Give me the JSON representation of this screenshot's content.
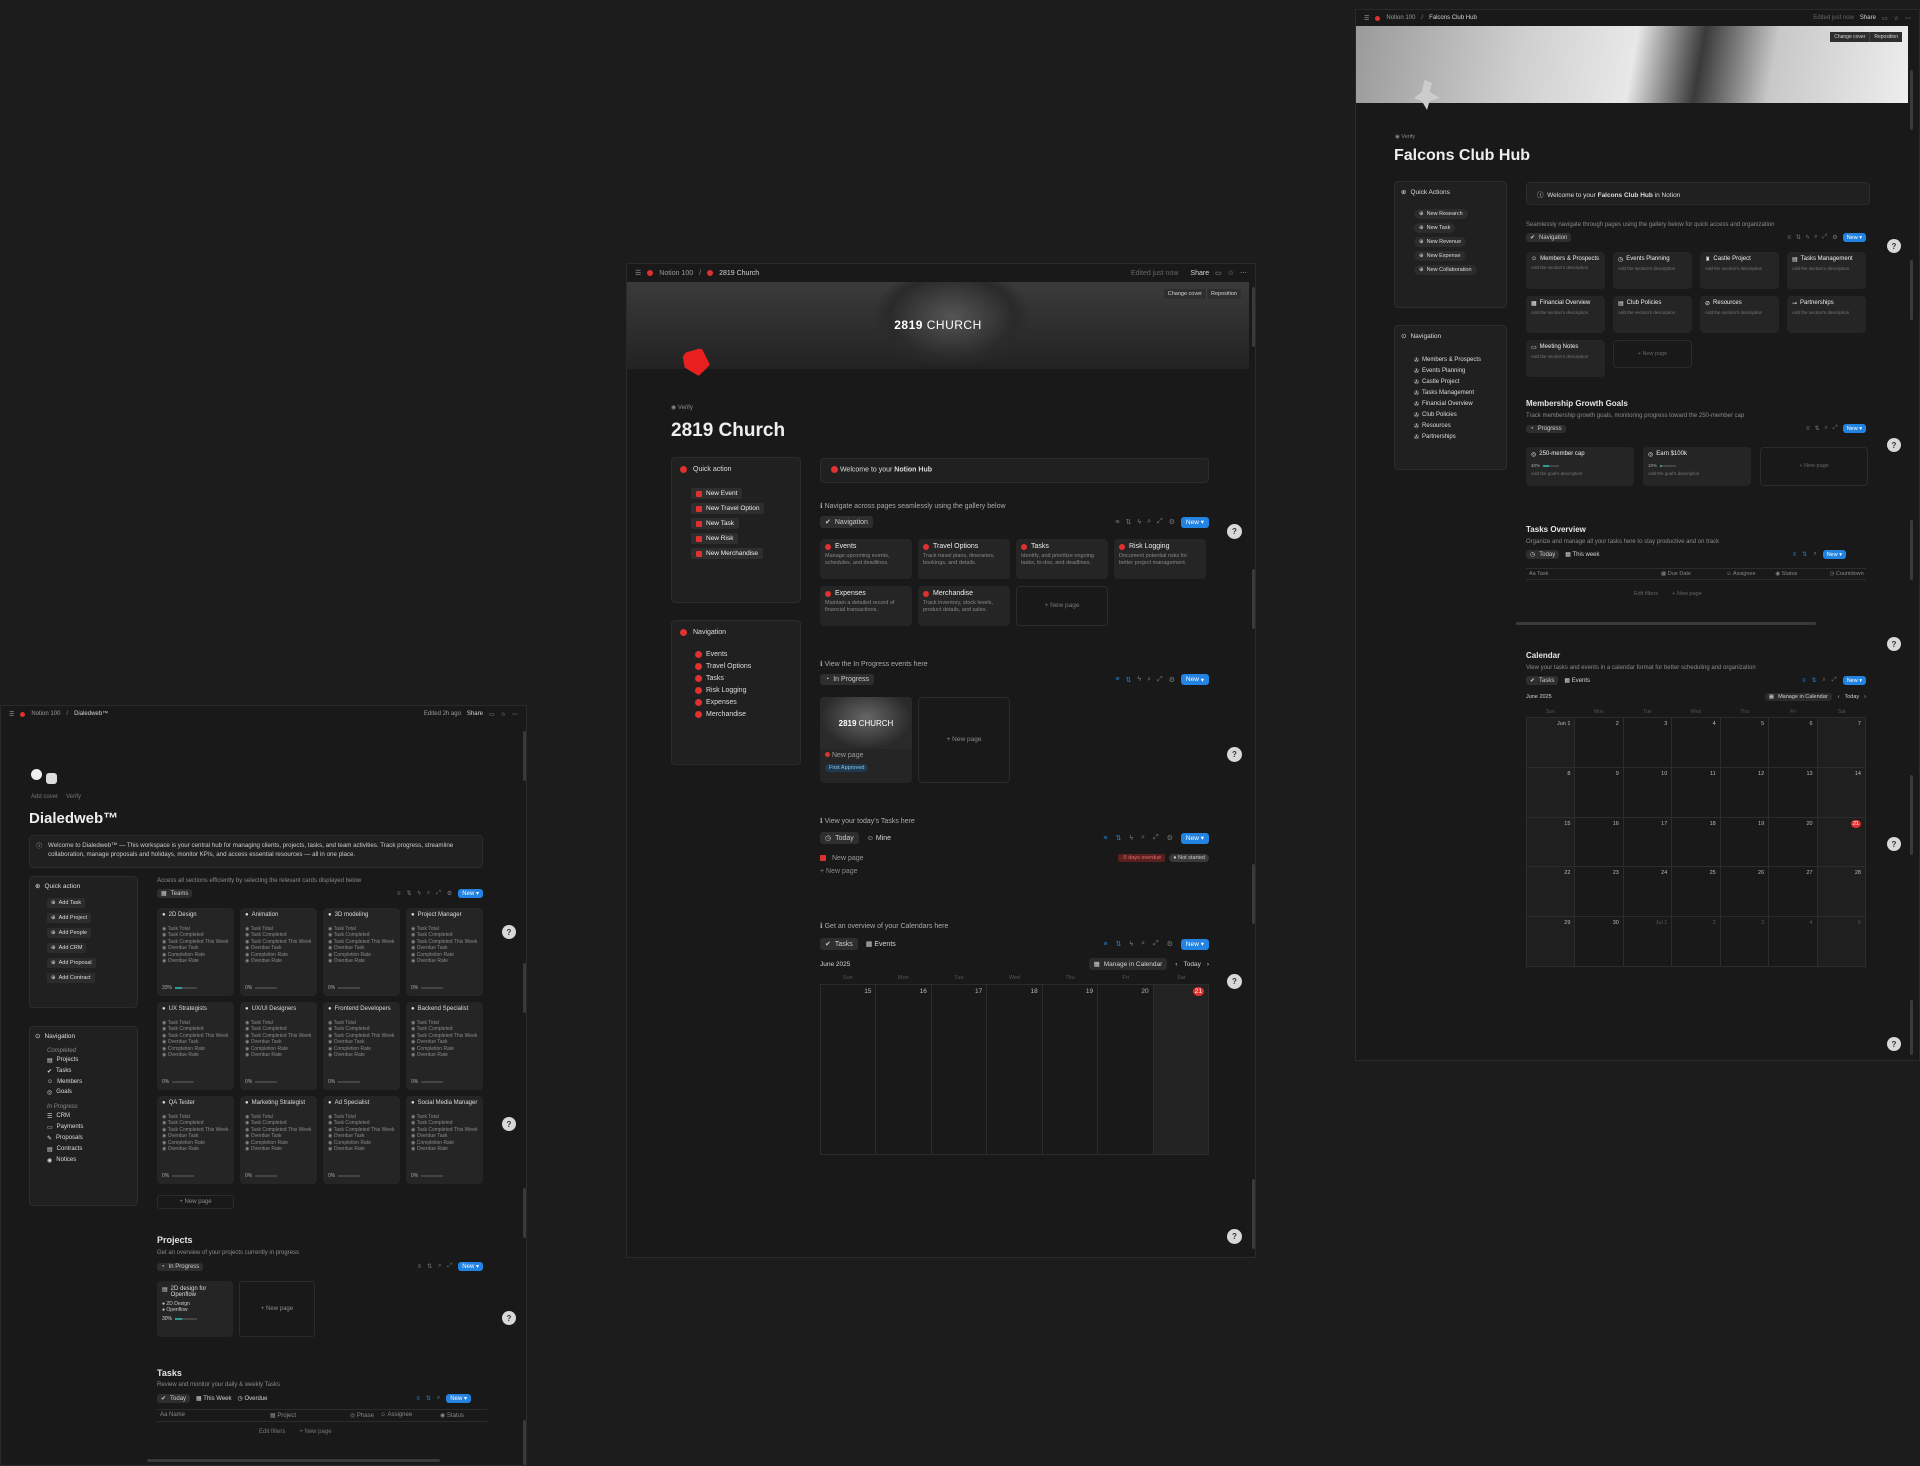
{
  "center": {
    "titlebar": {
      "workspace": "Notion 100",
      "page": "2819 Church",
      "edited": "Edited just now",
      "share": "Share"
    },
    "cover": {
      "brand_bold": "2819",
      "brand_light": "CHURCH",
      "change_cover": "Change cover",
      "reposition": "Reposition"
    },
    "verify": "Verify",
    "title": "2819 Church",
    "quick": {
      "title": "Quick action",
      "items": [
        "New Event",
        "New Travel Option",
        "New Task",
        "New Risk",
        "New Merchandise"
      ]
    },
    "nav": {
      "title": "Navigation",
      "items": [
        "Events",
        "Travel Options",
        "Tasks",
        "Risk Logging",
        "Expenses",
        "Merchandise"
      ]
    },
    "welcome": {
      "pre": "Welcome to your ",
      "bold": "Notion Hub"
    },
    "gallery": {
      "hint": "ℹ Navigate across pages seamlessly using the gallery below",
      "view": "Navigation",
      "new": "New",
      "cards": [
        {
          "title": "Events",
          "desc": "Manage upcoming events, schedules, and deadlines."
        },
        {
          "title": "Travel Options",
          "desc": "Track travel plans, itineraries, bookings, and details."
        },
        {
          "title": "Tasks",
          "desc": "Identify, and prioritize ongoing tasks, to-dos, and deadlines."
        },
        {
          "title": "Risk Logging",
          "desc": "Document potential risks for better project management."
        },
        {
          "title": "Expenses",
          "desc": "Maintain a detailed record of financial transactions."
        },
        {
          "title": "Merchandise",
          "desc": "Track inventory, stock levels, product details, and sales."
        }
      ],
      "new_page": "+ New page"
    },
    "inprog": {
      "hint": "ℹ View the In Progress events here",
      "view": "In Progress",
      "new": "New",
      "card_title": "New page",
      "badge": "First Approved",
      "new_page": "+ New page"
    },
    "tasks": {
      "hint": "ℹ View your today's Tasks here",
      "view1": "Today",
      "view2": "Mine",
      "new": "New",
      "row": "New page",
      "overdue": "-5 days overdue",
      "status": "Not started",
      "new_page": "+ New page"
    },
    "cal": {
      "hint": "ℹ Get an overview of your Calendars here",
      "view1": "Tasks",
      "view2": "Events",
      "new": "New",
      "month": "June 2025",
      "manage": "Manage in Calendar",
      "today": "Today",
      "days": [
        "Sun",
        "Mon",
        "Tue",
        "Wed",
        "Thu",
        "Fri",
        "Sat"
      ],
      "dates": [
        "15",
        "16",
        "17",
        "18",
        "19",
        "20",
        "21"
      ]
    }
  },
  "right": {
    "titlebar": {
      "workspace": "Notion 100",
      "page": "Falcons Club Hub",
      "edited": "Edited just now",
      "share": "Share"
    },
    "cover": {
      "change_cover": "Change cover",
      "reposition": "Reposition"
    },
    "verify": "Verify",
    "title": "Falcons Club Hub",
    "quick": {
      "title": "Quick Actions",
      "items": [
        "New Research",
        "New Task",
        "New Revenue",
        "New Expense",
        "New Collaboration"
      ]
    },
    "nav": {
      "title": "Navigation",
      "items": [
        "Members & Prospects",
        "Events Planning",
        "Castle Project",
        "Tasks Management",
        "Financial Overview",
        "Club Policies",
        "Resources",
        "Partnerships"
      ]
    },
    "welcome": {
      "pre": "Welcome to your ",
      "bold": "Falcons Club Hub",
      "post": " in Notion"
    },
    "gallery": {
      "hint": "Seamlessly navigate through pages using the gallery below for quick access and organization",
      "view": "Navigation",
      "new": "New",
      "cards": [
        "Members & Prospects",
        "Events Planning",
        "Castle Project",
        "Tasks Management",
        "Financial Overview",
        "Club Policies",
        "Resources",
        "Partnerships",
        "Meeting Notes"
      ],
      "desc": "Add the section's description",
      "new_page": "+ New page"
    },
    "growth": {
      "title": "Membership Growth Goals",
      "sub": "Track membership growth goals, monitoring progress toward the 250-member cap",
      "view": "Progress",
      "new": "New",
      "cards": [
        {
          "title": "250-member cap",
          "pct": "40%",
          "progress": 0.4
        },
        {
          "title": "Earn $100k",
          "pct": "10%",
          "progress": 0.1
        }
      ],
      "desc": "Add the goal's description",
      "new_page": "+ New page"
    },
    "tasks": {
      "title": "Tasks Overview",
      "sub": "Organize and manage all your tasks here to stay productive and on track",
      "view1": "Today",
      "view2": "This week",
      "new": "New",
      "cols": [
        "Task",
        "Due Date",
        "Assignee",
        "Status",
        "Countdown"
      ],
      "edit_filters": "Edit filters",
      "new_page": "+ New page"
    },
    "cal": {
      "title": "Calendar",
      "sub": "View your tasks and events in a calendar format for better scheduling and organization",
      "view1": "Tasks",
      "view2": "Events",
      "new": "New",
      "month": "June 2025",
      "manage": "Manage in Calendar",
      "today": "Today",
      "days": [
        "Sun",
        "Mon",
        "Tue",
        "Wed",
        "Thu",
        "Fri",
        "Sat"
      ],
      "dates": [
        "Jun 1",
        "2",
        "3",
        "4",
        "5",
        "6",
        "7",
        "8",
        "9",
        "10",
        "11",
        "12",
        "13",
        "14",
        "15",
        "16",
        "17",
        "18",
        "19",
        "20",
        "21",
        "22",
        "23",
        "24",
        "25",
        "26",
        "27",
        "28",
        "29",
        "30",
        "Jul 1",
        "2",
        "3",
        "4",
        "5"
      ]
    }
  },
  "left": {
    "titlebar": {
      "workspace": "Notion 100",
      "page": "Dialedweb™",
      "edited": "Edited 2h ago",
      "share": "Share"
    },
    "add_cover": "Add cover",
    "verify": "Verify",
    "title": "Dialedweb™",
    "welcome": "Welcome to Dialedweb™ — This workspace is your central hub for managing clients, projects, tasks, and team activities. Track progress, streamline collaboration, manage proposals and holidays, monitor KPIs, and access essential resources — all in one place.",
    "quick": {
      "title": "Quick action",
      "items": [
        "Add Task",
        "Add Project",
        "Add People",
        "Add CRM",
        "Add Proposal",
        "Add Contract"
      ]
    },
    "nav": {
      "title": "Navigation",
      "completed": "Completed",
      "completed_items": [
        "Projects",
        "Tasks",
        "Members",
        "Goals"
      ],
      "inprogress": "In Progress",
      "inprogress_items": [
        "CRM",
        "Payments",
        "Proposals",
        "Contracts",
        "Notices"
      ]
    },
    "teams": {
      "hint": "Access all sections efficiently by selecting the relevant cards displayed below",
      "view": "Teams",
      "new": "New",
      "cards": [
        {
          "title": "2D Design",
          "pct": "33%"
        },
        {
          "title": "Animation",
          "pct": "0%"
        },
        {
          "title": "3D modeling",
          "pct": "0%"
        },
        {
          "title": "Project Manager",
          "pct": "0%"
        },
        {
          "title": "UX Strategists",
          "pct": "0%"
        },
        {
          "title": "UX/UI Designers",
          "pct": "0%"
        },
        {
          "title": "Frontend Developers",
          "pct": "0%"
        },
        {
          "title": "Backend Specialist",
          "pct": "0%"
        },
        {
          "title": "QA Tester",
          "pct": "0%"
        },
        {
          "title": "Marketing Strategist",
          "pct": "0%"
        },
        {
          "title": "Ad Specialist",
          "pct": "0%"
        },
        {
          "title": "Social Media Manager",
          "pct": "0%"
        }
      ],
      "stats": [
        "Task Total",
        "Task Completed",
        "Task Completed This Week",
        "Overdue Task",
        "Completion Rate",
        "Overdue Rate"
      ],
      "new_page": "+ New page"
    },
    "projects": {
      "title": "Projects",
      "sub": "Get an overview of your projects currently in progress",
      "view": "In Progress",
      "new": "New",
      "card_title": "2D design for Openflow",
      "tag1": "2D Design",
      "tag2": "Openflow",
      "pct": "30%",
      "new_page": "+ New page"
    },
    "tasks": {
      "title": "Tasks",
      "sub": "Review and monitor your daily & weekly Tasks",
      "view1": "Today",
      "view2": "This Week",
      "view3": "Overdue",
      "new": "New",
      "cols": [
        "Name",
        "Project",
        "Phase",
        "Assignee",
        "Status"
      ],
      "edit_filters": "Edit filters",
      "new_page": "+ New page"
    }
  }
}
